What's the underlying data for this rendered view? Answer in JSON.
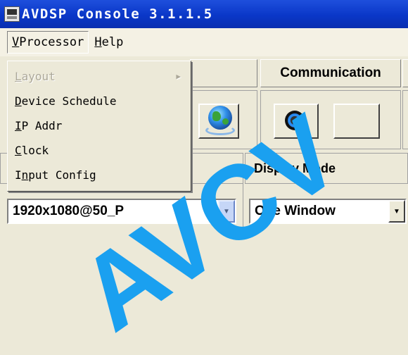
{
  "window": {
    "title": "AVDSP Console 3.1.1.5"
  },
  "menubar": {
    "items": [
      {
        "label": "VProcessor",
        "mnemonic": "V",
        "rest": "Processor"
      },
      {
        "label": "Help",
        "mnemonic": "H",
        "rest": "elp"
      }
    ]
  },
  "dropdown": {
    "items": [
      {
        "label": "Layout",
        "mnemonic": "L",
        "rest": "ayout",
        "enabled": false,
        "submenu": true
      },
      {
        "label": "Device Schedule",
        "mnemonic": "D",
        "rest": "evice Schedule",
        "enabled": true
      },
      {
        "label": "IP Addr",
        "mnemonic": "I",
        "rest": "P Addr",
        "enabled": true
      },
      {
        "label": "Clock",
        "mnemonic": "C",
        "rest": "lock",
        "enabled": true
      },
      {
        "label": "Input Config",
        "pre": "I",
        "mnemonic": "n",
        "rest": "put Config",
        "enabled": true
      }
    ]
  },
  "tabs": {
    "communication": "Communication"
  },
  "toolbar": {
    "icons": [
      "globe-icon",
      "record-icon"
    ]
  },
  "panels": {
    "display_mode": {
      "title": "Display Mode",
      "select_value": "One Window"
    },
    "resolution": {
      "select_value": "1920x1080@50_P"
    }
  },
  "watermark": {
    "text": "AVCV"
  },
  "colors": {
    "titlebar": "#0a37c8",
    "menu_bg": "#ece9d8",
    "watermark": "#1aa0f0"
  }
}
